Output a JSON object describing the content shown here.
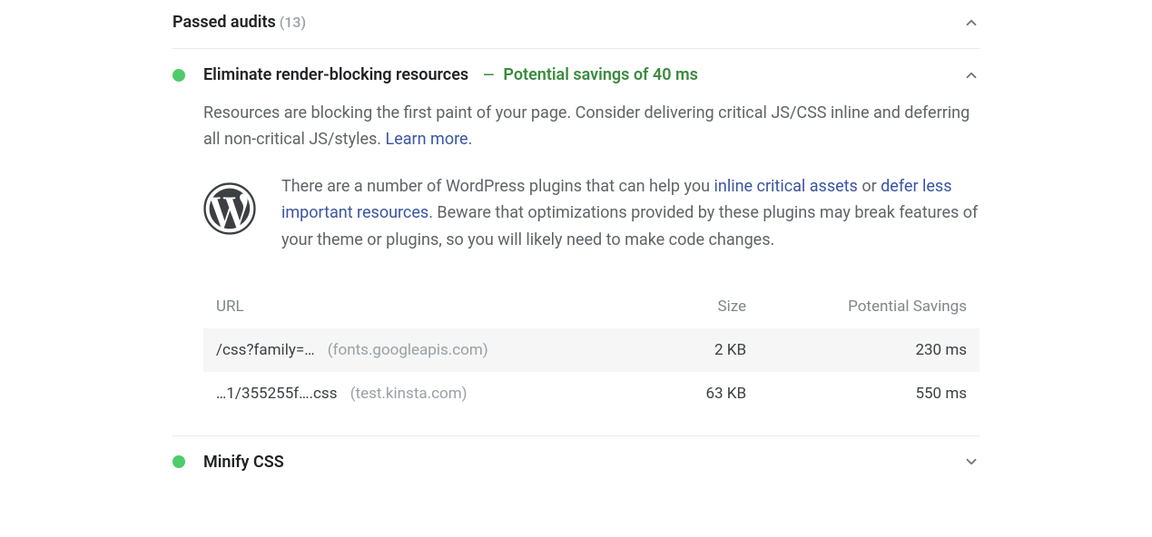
{
  "section": {
    "title": "Passed audits",
    "count": "(13)"
  },
  "audit1": {
    "title": "Eliminate render-blocking resources",
    "dash": "—",
    "savings": "Potential savings of 40 ms",
    "description_pre": "Resources are blocking the first paint of your page. Consider delivering critical JS/CSS inline and deferring all non-critical JS/styles. ",
    "learn_more": "Learn more",
    "description_post": ".",
    "wp_pre": "There are a number of WordPress plugins that can help you ",
    "wp_link1": "inline critical assets",
    "wp_mid1": " or ",
    "wp_link2": "defer less important resources",
    "wp_post": ". Beware that optimizations provided by these plugins may break features of your theme or plugins, so you will likely need to make code changes.",
    "table": {
      "headers": {
        "url": "URL",
        "size": "Size",
        "savings": "Potential Savings"
      },
      "rows": [
        {
          "path": "/css?family=…",
          "host": "(fonts.googleapis.com)",
          "size": "2 KB",
          "savings": "230 ms"
        },
        {
          "path": "…1/355255f….css",
          "host": "(test.kinsta.com)",
          "size": "63 KB",
          "savings": "550 ms"
        }
      ]
    }
  },
  "audit2": {
    "title": "Minify CSS"
  }
}
